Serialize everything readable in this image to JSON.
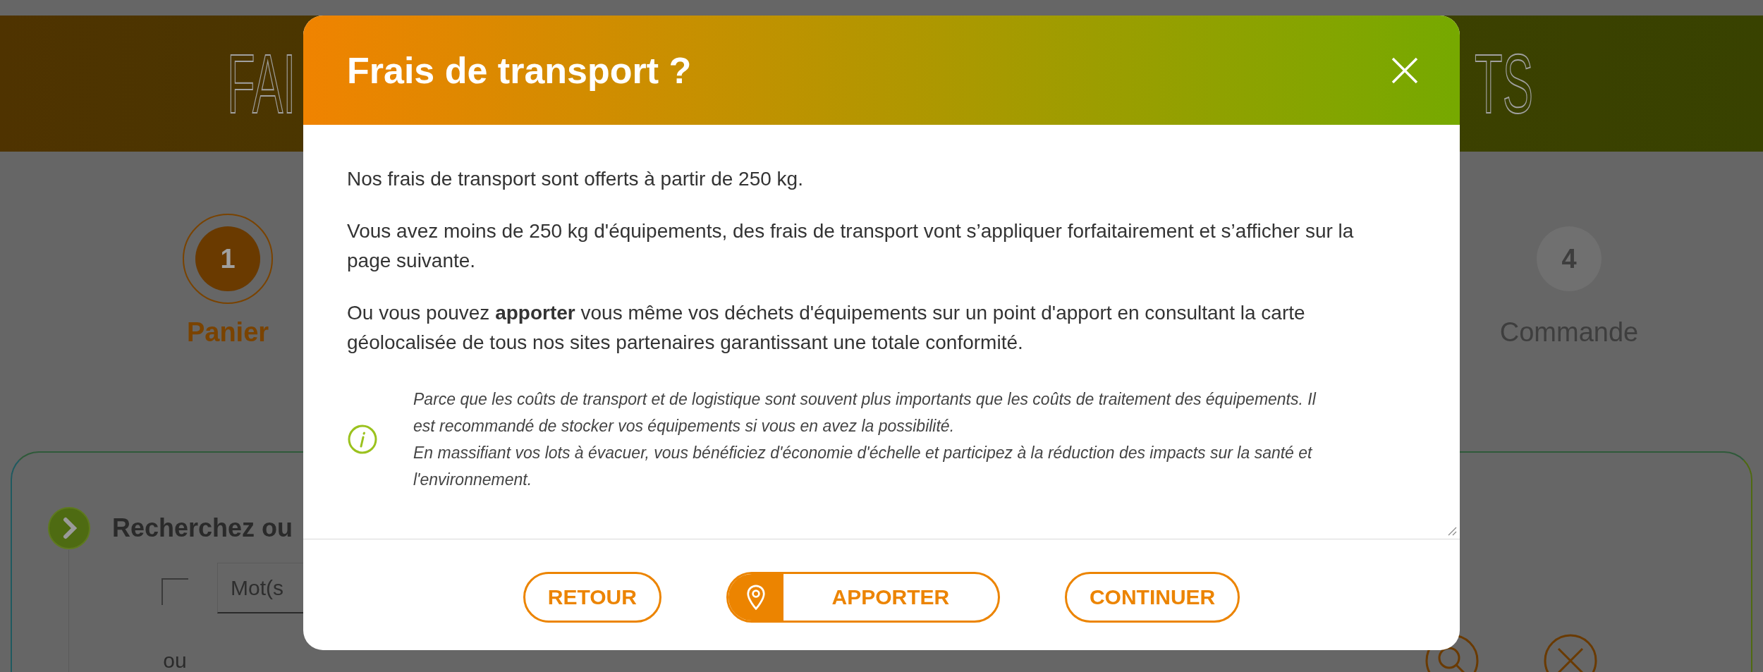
{
  "page": {
    "header_title_left": "FAI",
    "header_title_right": "TS",
    "steps": [
      {
        "number": "1",
        "label": "Panier",
        "selected": true
      },
      {
        "number": "4",
        "label": "Commande",
        "selected": false
      }
    ],
    "search_card": {
      "title": "Recherchez ou",
      "keyword_placeholder": "Mot(s",
      "or_label": "ou"
    }
  },
  "modal": {
    "title": "Frais de transport ?",
    "paragraphs": [
      "Nos frais de transport sont offerts à partir de 250 kg.",
      "Vous avez moins de 250 kg d'équipements, des frais de transport vont s’appliquer forfaitairement et s’afficher sur la page suivante.",
      "Ou vous pouvez **apporter** vous même vos déchets d'équipements sur un point d'apport en consultant la carte géolocalisée de tous nos sites partenaires garantissant une totale conformité."
    ],
    "note": [
      "Parce que les coûts de transport et de logistique sont souvent plus importants que les coûts de traitement des équipements. Il est recommandé de stocker vos équipements si vous en avez la possibilité.",
      "En massifiant vos lots à évacuer, vous bénéficiez d'économie d'échelle et participez à la réduction des impacts sur la santé et l'environnement."
    ],
    "buttons": [
      {
        "label": "RETOUR",
        "kind": "plain"
      },
      {
        "label": "APPORTER",
        "kind": "location"
      },
      {
        "label": "CONTINUER",
        "kind": "plain"
      }
    ]
  }
}
